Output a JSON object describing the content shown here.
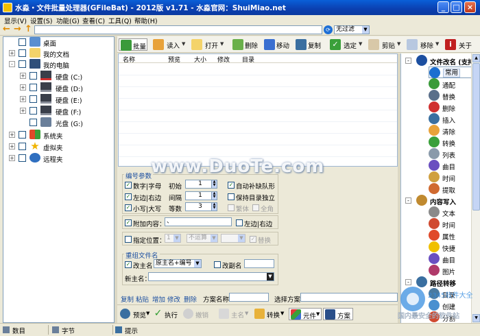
{
  "window": {
    "title": "水淼・文件批量处理器(GFileBat) - 2012版 v1.71 - 水淼官网：ShuiMiao.net",
    "min_label": "_",
    "max_label": "□",
    "close_label": "×"
  },
  "menu": [
    "显示(V)",
    "设置(S)",
    "功能(G)",
    "查看(C)",
    "工具(Q)",
    "帮助(H)"
  ],
  "address": {
    "value": "",
    "filter_value": "无过滤",
    "back_icon": "arrow-left-icon",
    "forward_icon": "arrow-right-icon",
    "up_icon": "arrow-up-icon"
  },
  "tree": [
    {
      "label": "桌面"
    },
    {
      "label": "我的文档"
    },
    {
      "label": "我的电脑"
    },
    {
      "label": "硬盘 (C:)"
    },
    {
      "label": "硬盘 (D:)"
    },
    {
      "label": "硬盘 (E:)"
    },
    {
      "label": "硬盘 (F:)"
    },
    {
      "label": "光盘 (G:)"
    },
    {
      "label": "系统夹"
    },
    {
      "label": "虚拟夹"
    },
    {
      "label": "远程夹"
    }
  ],
  "toolbar": {
    "batch": "批量",
    "read": "读入",
    "open": "打开",
    "delete": "删除",
    "move": "移动",
    "copy": "复制",
    "select": "选定",
    "cut": "剪贴",
    "remove": "移除",
    "close": "关于"
  },
  "filelist": {
    "columns": [
      "名称",
      "预览",
      "大小",
      "修改",
      "目录"
    ]
  },
  "numbering": {
    "group_label": "编号参数",
    "digit_sequence": "数字|字母",
    "start_label": "初始",
    "start_value": "1",
    "auto_fill": "自动补缺队形",
    "left_right": "左边|右边",
    "interval_label": "间隔",
    "interval_value": "1",
    "keep_dir": "保持目录独立",
    "case_label": "小写|大写",
    "digits_label": "等数",
    "digits_value": "3",
    "trad": "繁体",
    "fullwidth": "全角"
  },
  "append": {
    "label": "附加内容：",
    "value": "、",
    "left_right": "左边|右边"
  },
  "position": {
    "label": "指定位置：",
    "pos_value": "1",
    "op_value": "不运算",
    "extra_value": "",
    "replace": "替换"
  },
  "rename": {
    "group_label": "重组文件名",
    "change_main": "改主名",
    "main_value": "原主名+编号",
    "change_ext": "改副名",
    "ext_value": "",
    "new_main_label": "新主名：",
    "new_main_value": ""
  },
  "scheme": {
    "copy": "复制",
    "paste": "粘贴",
    "add": "增加",
    "modify": "修改",
    "delete": "删除",
    "name_label": "方案名称",
    "name_value": "",
    "select_label": "选择方案",
    "select_value": ""
  },
  "bottom": {
    "preview": "预览",
    "execute": "执行",
    "undo": "撤销",
    "main": "主名",
    "convert": "转换",
    "element": "元件",
    "scheme": "方案"
  },
  "rpanel": [
    {
      "label": "文件改名 (支持",
      "cat": true
    },
    {
      "label": "常用",
      "selected": true
    },
    {
      "label": "通配"
    },
    {
      "label": "替换"
    },
    {
      "label": "删除"
    },
    {
      "label": "插入"
    },
    {
      "label": "清除"
    },
    {
      "label": "转换"
    },
    {
      "label": "列表"
    },
    {
      "label": "曲目"
    },
    {
      "label": "时间"
    },
    {
      "label": "提取"
    },
    {
      "label": "内容写入",
      "cat": true
    },
    {
      "label": "文本"
    },
    {
      "label": "时间"
    },
    {
      "label": "属性"
    },
    {
      "label": "快捷"
    },
    {
      "label": "曲目"
    },
    {
      "label": "图片"
    },
    {
      "label": "路径转移",
      "cat": true
    },
    {
      "label": "目录"
    },
    {
      "label": "创建"
    },
    {
      "label": "分割"
    }
  ],
  "status": {
    "count": "数目",
    "bytes": "字节",
    "hint": "提示"
  },
  "watermark": {
    "text": "www.DuoTe.com",
    "logo_text": "2345软件大全",
    "logo_sub": "国内最安全的软件站"
  },
  "colors": {
    "titlebar": "#0b3fb0",
    "accent_blue": "#1c4fa0",
    "check_green": "#1c7a1c"
  }
}
